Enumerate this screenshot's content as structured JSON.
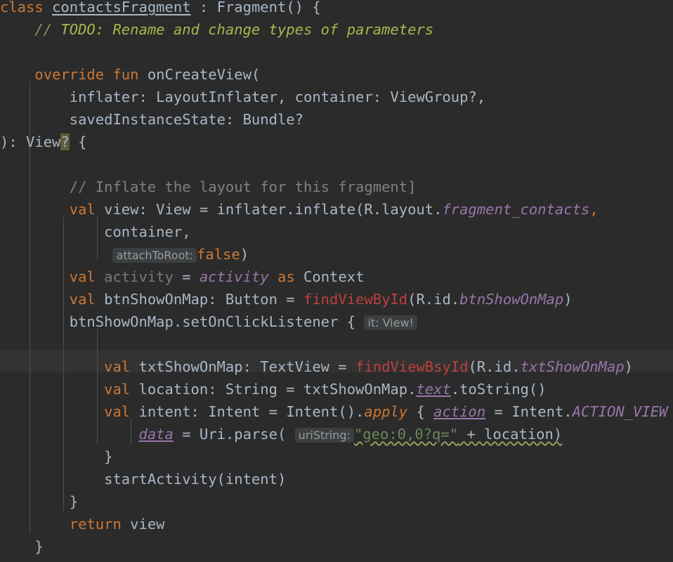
{
  "editor": {
    "language": "Kotlin",
    "theme": "Darcula",
    "background_color": "#2b2b2b",
    "caret_line_color": "#323232",
    "font_size_px": 20,
    "caret_line_index": 15
  },
  "colors": {
    "default_text": "#a9b7c6",
    "keyword": "#cc7832",
    "comment": "#808080",
    "todo_comment": "#a5b94d",
    "string": "#6a8759",
    "field_italic": "#9876aa",
    "error_red": "#bc3f3c",
    "greyed_unused": "#787878",
    "inlay_hint_bg": "#3c3f41",
    "inlay_hint_fg": "#9a9a9a",
    "match_highlight_bg": "#5e5c3a",
    "indent_guide": "#4e5254"
  },
  "code": {
    "line_01": {
      "kw_class": "class",
      "class_name": "contactsFragment",
      "colon": " : ",
      "super": "Fragment() {"
    },
    "line_02": {
      "slashes": "//",
      "todo_text": " TODO: Rename and change types of parameters"
    },
    "line_04": {
      "kw_override": "override",
      "kw_fun": "fun",
      "fn_name": "onCreateView("
    },
    "line_05": {
      "param1": "inflater: LayoutInflater,",
      "param2_pre": " container: ViewGroup",
      "param2_q": "?,"
    },
    "line_06": {
      "param3": "savedInstanceState: Bundle?"
    },
    "line_07": {
      "close_paren": "): View",
      "q_highlight": "?",
      "brace": " {"
    },
    "line_09": {
      "comment": "// Inflate the layout for this fragment]"
    },
    "line_10": {
      "kw_val": "val",
      "rest1": " view: View = inflater.inflate(R.layout.",
      "field": "fragment_contacts",
      "comma": ","
    },
    "line_11": {
      "text": "container,"
    },
    "line_12": {
      "hint": "attachToRoot:",
      "value": "false",
      "close": ")"
    },
    "line_13": {
      "kw_val": "val",
      "name_unused": " activity ",
      "eq": "= ",
      "field": "activity",
      "kw_as": " as ",
      "type": "Context"
    },
    "line_14": {
      "kw_val": "val",
      "decl": " btnShowOnMap: Button = ",
      "fn": "findViewById",
      "open": "(R.id.",
      "field": "btnShowOnMap",
      "close": ")"
    },
    "line_15": {
      "call": "btnShowOnMap.setOnClickListener {",
      "hint": "it: View!"
    },
    "line_17": {
      "kw_val": "val",
      "decl": " txtShowOnMap: TextView = ",
      "fn": "findViewBsyId",
      "open": "(R.id.",
      "field": "txtShowOnMap",
      "close": ")"
    },
    "line_18": {
      "kw_val": "val",
      "decl": " location: String = txtShowOnMap.",
      "field": "text",
      "tail": ".toString()"
    },
    "line_19": {
      "kw_val": "val",
      "decl": " intent: Intent = Intent().",
      "apply": "apply",
      "brace": " { ",
      "action": "action",
      "eq": " = Intent.",
      "const": "ACTION_VIEW"
    },
    "line_20": {
      "data": "data",
      "eq": " = Uri.parse(",
      "hint": "uriString:",
      "string": "\"geo:0,0?q=\"",
      "plus_location": " + location)"
    },
    "line_21": {
      "text": "}"
    },
    "line_22": {
      "text": "startActivity(intent)"
    },
    "line_23": {
      "text": "}"
    },
    "line_24": {
      "kw_return": "return",
      "value": " view"
    },
    "line_25": {
      "text": "}"
    }
  }
}
